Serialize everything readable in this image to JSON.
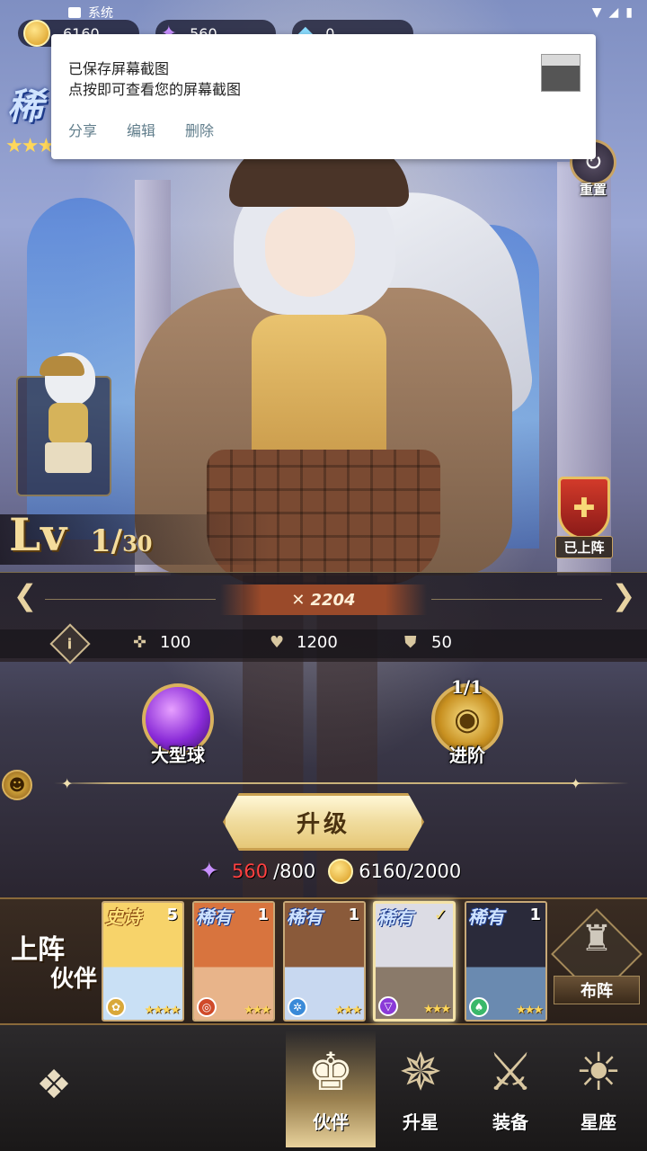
{
  "status_bar": {
    "notification_label": "系统"
  },
  "currency": [
    {
      "name": "gold",
      "value": "6160"
    },
    {
      "name": "crystal",
      "value": "560"
    },
    {
      "name": "diamond",
      "value": "0"
    }
  ],
  "notification": {
    "title": "已保存屏幕截图",
    "body": "点按即可查看您的屏幕截图",
    "actions": [
      "分享",
      "编辑",
      "删除"
    ]
  },
  "hero": {
    "rarity": "稀",
    "stars": "★★★",
    "reset_label": "重置",
    "level_label": "Lv",
    "level": "1/",
    "level_max": "30",
    "deployed_label": "已上阵",
    "power": "2204",
    "stats": [
      {
        "icon": "attack-icon",
        "value": "100"
      },
      {
        "icon": "heart-icon",
        "value": "1200"
      },
      {
        "icon": "shield-icon",
        "value": "50"
      }
    ],
    "skill_label": "大型球",
    "advance_label": "进阶",
    "advance_count": "1/1"
  },
  "upgrade": {
    "button_label": "升级",
    "crystal_have": "560",
    "crystal_need": "/800",
    "gold_cost": "6160/2000"
  },
  "team": {
    "title": "上阵",
    "subtitle": "伙伴",
    "formation_label": "布阵",
    "cards": [
      {
        "rarity": "史诗",
        "level": "5",
        "stars": "★★★★",
        "element_color": "#d9a83a",
        "art": [
          "#f7d36a",
          "#c9e0f5"
        ]
      },
      {
        "rarity": "稀有",
        "level": "1",
        "stars": "★★★",
        "element_color": "#d04a2a",
        "art": [
          "#d8743e",
          "#e8b48a"
        ]
      },
      {
        "rarity": "稀有",
        "level": "1",
        "stars": "★★★",
        "element_color": "#3a8ad8",
        "art": [
          "#8a5a3a",
          "#c8d8f0"
        ]
      },
      {
        "rarity": "稀有",
        "level": "✓",
        "stars": "★★★",
        "element_color": "#8a3ad8",
        "art": [
          "#dcdce4",
          "#8a7a6a"
        ]
      },
      {
        "rarity": "稀有",
        "level": "1",
        "stars": "★★★",
        "element_color": "#3ab86a",
        "art": [
          "#2a2a3a",
          "#6a8ab0"
        ]
      }
    ]
  },
  "bottom_nav": {
    "tabs": [
      {
        "label": "伙伴",
        "icon": "chess-king-icon"
      },
      {
        "label": "升星",
        "icon": "star-crest-icon"
      },
      {
        "label": "装备",
        "icon": "sword-icon"
      },
      {
        "label": "星座",
        "icon": "sun-icon"
      }
    ]
  }
}
